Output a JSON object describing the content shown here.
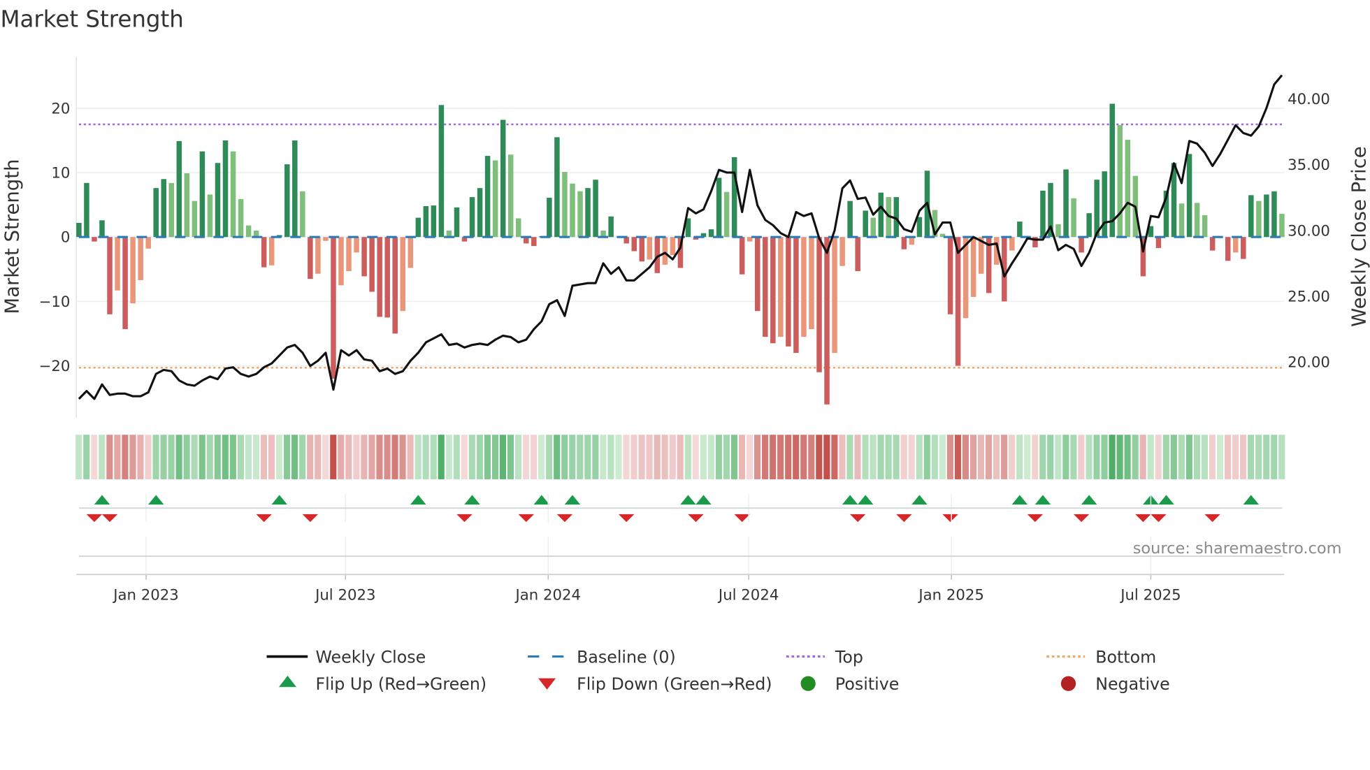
{
  "chart_data": {
    "type": "bar",
    "title": "Market Strength",
    "ylabel": "Market Strength",
    "y2label": "Weekly Close Price",
    "source": "source: sharemaestro.com",
    "frequency": "weekly",
    "start_week": "2022-11-01",
    "ylim": [
      -28,
      28
    ],
    "y2lim": [
      15.8,
      43.2
    ],
    "yticks": [
      -20,
      -10,
      0,
      10,
      20
    ],
    "ytick_labels": [
      "−20",
      "−10",
      "0",
      "10",
      "20"
    ],
    "y2ticks": [
      20,
      25,
      30,
      35,
      40
    ],
    "y2tick_labels": [
      "20.00",
      "25.00",
      "30.00",
      "35.00",
      "40.00"
    ],
    "xticks": [
      "2023-01-01",
      "2023-07-01",
      "2024-01-01",
      "2024-07-01",
      "2025-01-01",
      "2025-07-01"
    ],
    "xtick_labels": [
      "Jan 2023",
      "Jul 2023",
      "Jan 2024",
      "Jul 2024",
      "Jan 2025",
      "Jul 2025"
    ],
    "top_level": 17.5,
    "bottom_level": -20.3,
    "baseline": 0,
    "colors": {
      "pos_strong": "#2e8b57",
      "pos_weak": "#7fbf7b",
      "neg_strong": "#cd5c5c",
      "neg_weak": "#e9967a",
      "close": "#111111",
      "baseline": "#2b7bb9",
      "top": "#a066e0",
      "bottom": "#f0a868",
      "flip_up": "#1a9a4a",
      "flip_down": "#d62728",
      "positive": "#228b22",
      "negative": "#b22222"
    },
    "strength": [
      2.2,
      8.4,
      -0.7,
      2.6,
      -12,
      -8.3,
      -14.3,
      -10.3,
      -6.7,
      -1.8,
      7.6,
      9,
      8.4,
      14.9,
      9.9,
      5.6,
      13.3,
      6.6,
      11.5,
      15,
      13.3,
      5.9,
      1.8,
      1.0,
      -4.7,
      -4.4,
      0.3,
      11.3,
      15,
      7.1,
      -6.5,
      -5.7,
      -0.6,
      -22,
      -7.5,
      -5.3,
      -2.4,
      -6.1,
      -8.5,
      -12.4,
      -12.5,
      -15,
      -11.5,
      -4.8,
      3,
      4.8,
      4.9,
      20.5,
      1,
      4.6,
      -0.7,
      6.2,
      7.6,
      12.6,
      11.9,
      18.2,
      12.8,
      2.9,
      -1,
      -1.4,
      0.1,
      6.1,
      15.5,
      10.1,
      8.3,
      7.1,
      7.6,
      8.9,
      1,
      3.2,
      0.1,
      -1,
      -2.2,
      -3.8,
      -3.5,
      -5.6,
      -4.3,
      -2.8,
      -4.8,
      2.9,
      -0.4,
      0.6,
      1.2,
      9.2,
      7,
      12.4,
      -5.8,
      -0.7,
      -11.5,
      -15.5,
      -16.5,
      -15.5,
      -17,
      -18,
      -15.5,
      -14.3,
      -21,
      -26,
      -18,
      -4.5,
      5.6,
      -5.3,
      4.1,
      3,
      6.9,
      6.2,
      6.2,
      -1.9,
      -1.2,
      3.1,
      10.3,
      4.2,
      0.5,
      -12,
      -20,
      -12.6,
      -9.3,
      -5.7,
      -8.7,
      -4.3,
      -10,
      -2.1,
      2.4,
      0.1,
      -1.6,
      7.2,
      8.4,
      2,
      10.5,
      6,
      -2.4,
      3.7,
      8.9,
      10.2,
      20.7,
      17.4,
      15.1,
      9.5,
      -6.1,
      1.7,
      -1.7,
      7.2,
      11.5,
      5.2,
      12.9,
      5.3,
      3.4,
      -2.1,
      0.1,
      -3.7,
      -2.4,
      -3.4,
      6.5,
      5.6,
      6.6,
      7.1,
      3.6
    ],
    "weekly_close": [
      17.2,
      17.8,
      17.2,
      18.3,
      17.5,
      17.6,
      17.6,
      17.4,
      17.4,
      17.7,
      19.1,
      19.4,
      19.3,
      18.6,
      18.3,
      18.2,
      18.6,
      18.9,
      18.7,
      19.5,
      19.6,
      19.1,
      18.9,
      19.1,
      19.6,
      19.9,
      20.5,
      21.1,
      21.3,
      20.7,
      19.7,
      20.1,
      20.7,
      17.9,
      20.9,
      20.5,
      20.9,
      20.2,
      20.1,
      19.3,
      19.5,
      19.1,
      19.3,
      20.1,
      20.7,
      21.5,
      21.8,
      22.1,
      21.3,
      21.4,
      21.1,
      21.3,
      21.4,
      21.3,
      21.7,
      22.0,
      21.9,
      21.5,
      21.7,
      22.5,
      23.1,
      24.4,
      24.7,
      23.5,
      25.8,
      25.9,
      26.0,
      26.0,
      27.5,
      26.7,
      27.2,
      26.2,
      26.2,
      26.7,
      27.2,
      28.0,
      28.3,
      27.8,
      28.7,
      31.7,
      31.3,
      31.6,
      33.0,
      34.6,
      34.4,
      34.4,
      31.4,
      34.6,
      31.9,
      30.8,
      30.4,
      29.8,
      29.5,
      31.4,
      31.1,
      31.3,
      29.4,
      28.3,
      30.0,
      33.2,
      33.8,
      32.4,
      32.5,
      31.2,
      31.8,
      31.1,
      30.9,
      30.1,
      29.9,
      31.5,
      32.1,
      29.7,
      30.6,
      30.6,
      28.3,
      28.9,
      29.5,
      29.2,
      28.9,
      29.0,
      26.5,
      27.5,
      28.4,
      29.4,
      29.3,
      29.3,
      30.3,
      28.5,
      28.9,
      28.6,
      27.3,
      28.3,
      29.8,
      30.6,
      30.7,
      31.3,
      32.1,
      31.8,
      28.4,
      31.1,
      31.0,
      32.5,
      35.1,
      33.6,
      36.8,
      36.6,
      35.9,
      34.9,
      35.8,
      36.9,
      38.0,
      37.4,
      37.2,
      37.9,
      39.3,
      41.1,
      41.8
    ],
    "flip_up_weeks": [
      3,
      10,
      26,
      44,
      51,
      60,
      64,
      79,
      81,
      100,
      102,
      109,
      122,
      125,
      131,
      139,
      141,
      152
    ],
    "flip_down_weeks": [
      2,
      4,
      24,
      30,
      50,
      58,
      63,
      71,
      80,
      86,
      101,
      107,
      113,
      124,
      130,
      138,
      140,
      147
    ],
    "legend": {
      "placement": "bottom",
      "items": [
        {
          "key": "close",
          "label": "Weekly Close"
        },
        {
          "key": "baseline",
          "label": "Baseline (0)"
        },
        {
          "key": "top",
          "label": "Top"
        },
        {
          "key": "bottom",
          "label": "Bottom"
        },
        {
          "key": "flip_up",
          "label": "Flip Up (Red→Green)"
        },
        {
          "key": "flip_down",
          "label": "Flip Down (Green→Red)"
        },
        {
          "key": "positive",
          "label": "Positive"
        },
        {
          "key": "negative",
          "label": "Negative"
        }
      ]
    }
  }
}
